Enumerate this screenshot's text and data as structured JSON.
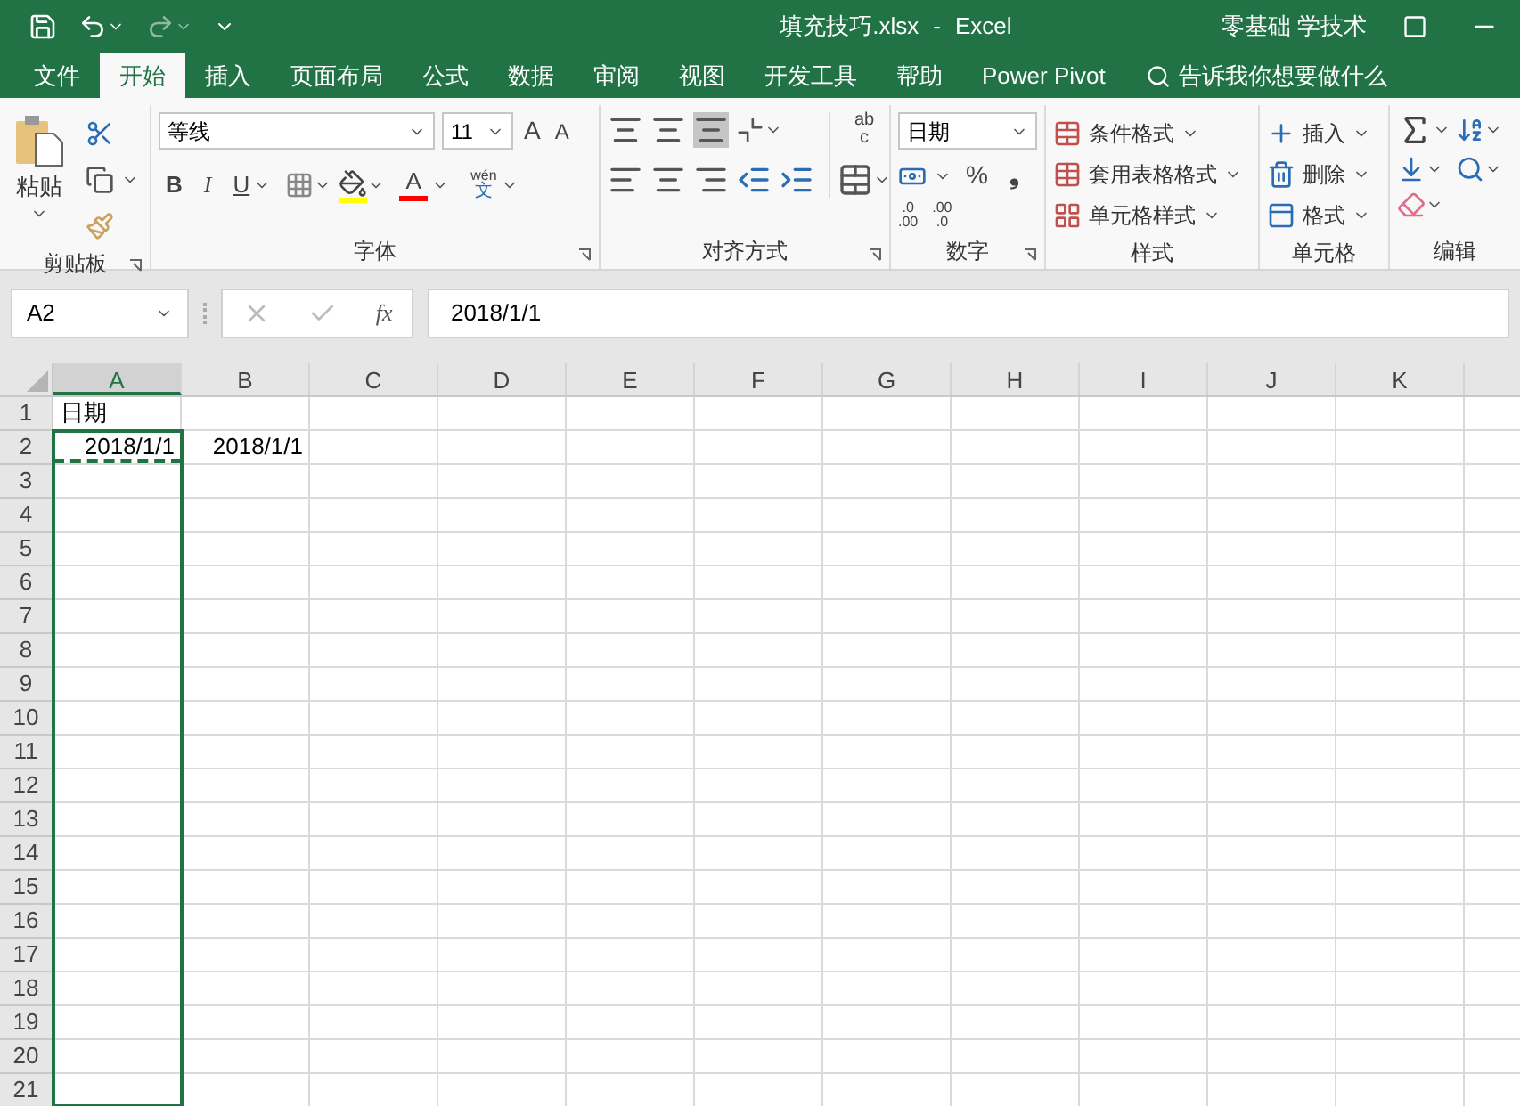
{
  "title_bar": {
    "file_name": "填充技巧.xlsx",
    "separator": "-",
    "app": "Excel",
    "user": "零基础 学技术"
  },
  "ribbon_tabs": [
    {
      "label": "文件",
      "selected": false
    },
    {
      "label": "开始",
      "selected": true
    },
    {
      "label": "插入",
      "selected": false
    },
    {
      "label": "页面布局",
      "selected": false
    },
    {
      "label": "公式",
      "selected": false
    },
    {
      "label": "数据",
      "selected": false
    },
    {
      "label": "审阅",
      "selected": false
    },
    {
      "label": "视图",
      "selected": false
    },
    {
      "label": "开发工具",
      "selected": false
    },
    {
      "label": "帮助",
      "selected": false
    },
    {
      "label": "Power Pivot",
      "selected": false
    }
  ],
  "tell_me": "告诉我你想要做什么",
  "ribbon": {
    "clipboard": {
      "paste": "粘贴",
      "label": "剪贴板"
    },
    "font": {
      "name": "等线",
      "size": "11",
      "grow": "A",
      "shrink": "A",
      "bold": "B",
      "italic": "I",
      "underline": "U",
      "font_color": "A",
      "phonetic_top": "wén",
      "phonetic_bottom": "文",
      "label": "字体"
    },
    "alignment": {
      "wrap_top": "ab",
      "wrap_bottom": "c",
      "label": "对齐方式"
    },
    "number": {
      "format": "日期",
      "percent": "%",
      "comma": "❟",
      "increase_decimal": [
        ".0",
        ".00"
      ],
      "decrease_decimal": [
        ".00",
        ".0"
      ],
      "label": "数字"
    },
    "styles": {
      "items": [
        "条件格式",
        "套用表格格式",
        "单元格样式"
      ],
      "label": "样式"
    },
    "cells": {
      "items": [
        "插入",
        "删除",
        "格式"
      ],
      "label": "单元格"
    },
    "editing": {
      "label": "编辑"
    }
  },
  "formula_bar": {
    "name_box": "A2",
    "fx": "fx",
    "value": "2018/1/1"
  },
  "grid": {
    "columns": [
      {
        "label": "A",
        "selected": true
      },
      {
        "label": "B",
        "selected": false
      },
      {
        "label": "C",
        "selected": false
      },
      {
        "label": "D",
        "selected": false
      },
      {
        "label": "E",
        "selected": false
      },
      {
        "label": "F",
        "selected": false
      },
      {
        "label": "G",
        "selected": false
      },
      {
        "label": "H",
        "selected": false
      },
      {
        "label": "I",
        "selected": false
      },
      {
        "label": "J",
        "selected": false
      },
      {
        "label": "K",
        "selected": false
      }
    ],
    "rows": [
      {
        "number": "1",
        "in_selection": false,
        "cells": [
          {
            "text": "日期",
            "kind": "text",
            "marquee": false
          }
        ]
      },
      {
        "number": "2",
        "in_selection": true,
        "cells": [
          {
            "text": "2018/1/1",
            "kind": "date",
            "marquee": true
          },
          {
            "text": "2018/1/1",
            "kind": "date",
            "marquee": false
          }
        ]
      },
      {
        "number": "3",
        "in_selection": true,
        "cells": []
      },
      {
        "number": "4",
        "in_selection": true,
        "cells": []
      },
      {
        "number": "5",
        "in_selection": true,
        "cells": []
      },
      {
        "number": "6",
        "in_selection": true,
        "cells": []
      },
      {
        "number": "7",
        "in_selection": true,
        "cells": []
      },
      {
        "number": "8",
        "in_selection": true,
        "cells": []
      },
      {
        "number": "9",
        "in_selection": true,
        "cells": []
      },
      {
        "number": "10",
        "in_selection": true,
        "cells": []
      },
      {
        "number": "11",
        "in_selection": true,
        "cells": []
      },
      {
        "number": "12",
        "in_selection": true,
        "cells": []
      },
      {
        "number": "13",
        "in_selection": true,
        "cells": []
      },
      {
        "number": "14",
        "in_selection": true,
        "cells": []
      },
      {
        "number": "15",
        "in_selection": true,
        "cells": []
      },
      {
        "number": "16",
        "in_selection": true,
        "cells": []
      },
      {
        "number": "17",
        "in_selection": true,
        "cells": []
      },
      {
        "number": "18",
        "in_selection": true,
        "cells": []
      },
      {
        "number": "19",
        "in_selection": true,
        "cells": []
      },
      {
        "number": "20",
        "in_selection": true,
        "cells": []
      },
      {
        "number": "21",
        "in_selection": true,
        "cells": []
      }
    ]
  }
}
